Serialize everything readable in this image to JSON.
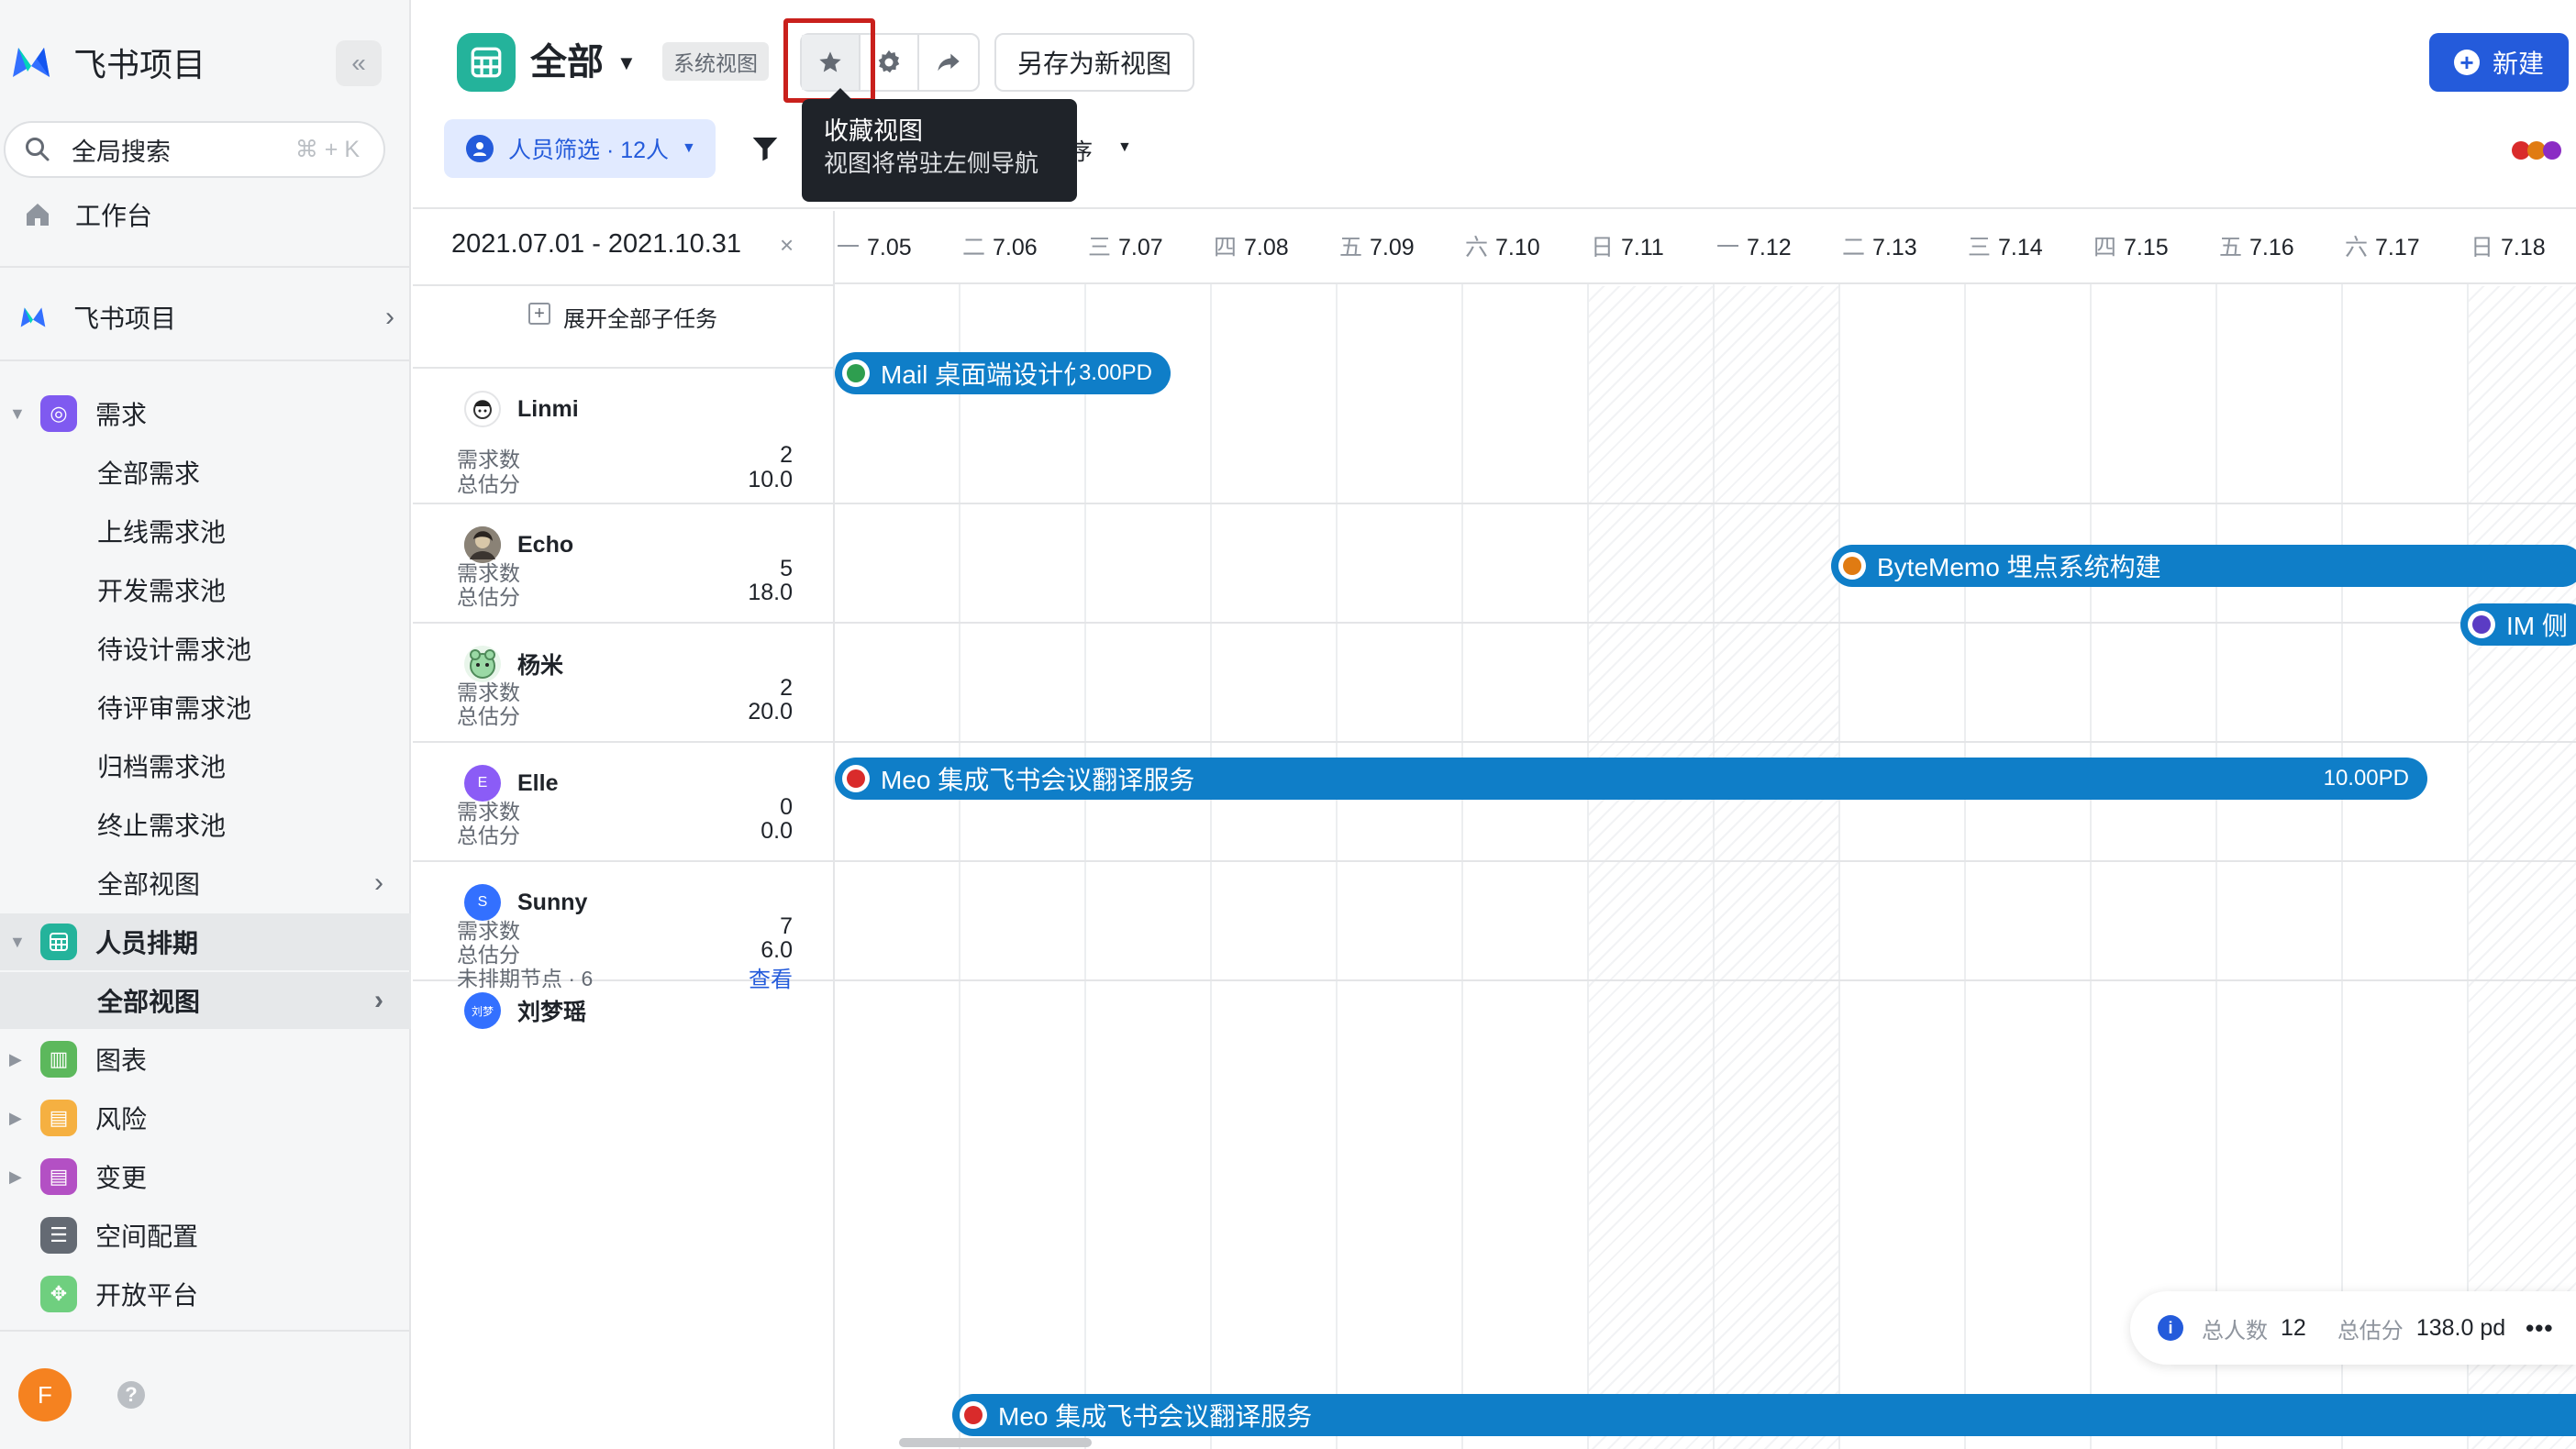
{
  "sidebar": {
    "app_name": "飞书项目",
    "search_label": "全局搜索",
    "search_shortcut": "⌘ + K",
    "workbench": "工作台",
    "project": "飞书项目",
    "sections": [
      {
        "label": "需求",
        "color": "#7f5af0",
        "expanded": true
      },
      {
        "label": "人员排期",
        "color": "#24b39b",
        "expanded": true
      },
      {
        "label": "图表",
        "color": "#5cb85c"
      },
      {
        "label": "风险",
        "color": "#f5b041"
      },
      {
        "label": "变更",
        "color": "#b350c4"
      },
      {
        "label": "空间配置",
        "color": "#646a73"
      },
      {
        "label": "开放平台",
        "color": "#6fcf7f"
      }
    ],
    "req_items": [
      "全部需求",
      "上线需求池",
      "开发需求池",
      "待设计需求池",
      "待评审需求池",
      "归档需求池",
      "终止需求池",
      "全部视图"
    ],
    "sched_items": [
      "全部视图"
    ],
    "user_initial": "F",
    "help": "?"
  },
  "header": {
    "title": "全部",
    "system_tag": "系统视图",
    "save_as": "另存为新视图",
    "new_btn": "新建",
    "filter": "人员筛选 · 12人",
    "sort_partial": "序"
  },
  "tooltip": {
    "title": "收藏视图",
    "desc": "视图将常驻左侧导航"
  },
  "people_panel": {
    "date_range": "2021.07.01 - 2021.10.31",
    "close": "×",
    "expand_all": "展开全部子任务",
    "people": [
      {
        "name": "Linmi",
        "count_label": "需求数",
        "count": "2",
        "score_label": "总估分",
        "score": "10.0",
        "avatar_color": "#ffffff"
      },
      {
        "name": "Echo",
        "count_label": "需求数",
        "count": "5",
        "score_label": "总估分",
        "score": "18.0",
        "avatar_color": "#6b6b6b"
      },
      {
        "name": "杨米",
        "count_label": "需求数",
        "count": "2",
        "score_label": "总估分",
        "score": "20.0",
        "avatar_color": "#9ad9a5"
      },
      {
        "name": "Elle",
        "initial": "E",
        "count_label": "需求数",
        "count": "0",
        "score_label": "总估分",
        "score": "0.0",
        "avatar_color": "#8b5cf6"
      },
      {
        "name": "Sunny",
        "initial": "S",
        "count_label": "需求数",
        "count": "7",
        "score_label": "总估分",
        "score": "6.0",
        "unscheduled": "未排期节点 · 6",
        "view_link": "查看",
        "avatar_color": "#3370ff"
      },
      {
        "name": "刘梦瑶",
        "initial": "刘梦",
        "avatar_color": "#3370ff"
      }
    ]
  },
  "timeline": {
    "days": [
      {
        "wk": "一",
        "d": "7.05"
      },
      {
        "wk": "二",
        "d": "7.06"
      },
      {
        "wk": "三",
        "d": "7.07"
      },
      {
        "wk": "四",
        "d": "7.08"
      },
      {
        "wk": "五",
        "d": "7.09"
      },
      {
        "wk": "六",
        "d": "7.10"
      },
      {
        "wk": "日",
        "d": "7.11"
      },
      {
        "wk": "一",
        "d": "7.12"
      },
      {
        "wk": "二",
        "d": "7.13"
      },
      {
        "wk": "三",
        "d": "7.14"
      },
      {
        "wk": "四",
        "d": "7.15"
      },
      {
        "wk": "五",
        "d": "7.16"
      },
      {
        "wk": "六",
        "d": "7.17"
      },
      {
        "wk": "日",
        "d": "7.18"
      }
    ],
    "bars": [
      {
        "label": "Mail 桌面端设计优化",
        "estimate": "3.00PD",
        "status_color": "#2e9e4f"
      },
      {
        "label": "ByteMemo 埋点系统构建",
        "estimate": "",
        "status_color": "#e07b12"
      },
      {
        "label": "IM 侧",
        "estimate": "",
        "status_color": "#5b3cc4"
      },
      {
        "label": "Meo 集成飞书会议翻译服务",
        "estimate": "10.00PD",
        "status_color": "#d92b2b"
      },
      {
        "label": "Meo 集成飞书会议翻译服务",
        "estimate": "",
        "status_color": "#d92b2b"
      }
    ]
  },
  "summary": {
    "people_label": "总人数",
    "people_value": "12",
    "score_label": "总估分",
    "score_value": "138.0 pd",
    "more": "•••"
  },
  "colors": {
    "accent": "#245bdb",
    "bar": "#0f7ec8",
    "highlight": "#c9201c"
  }
}
